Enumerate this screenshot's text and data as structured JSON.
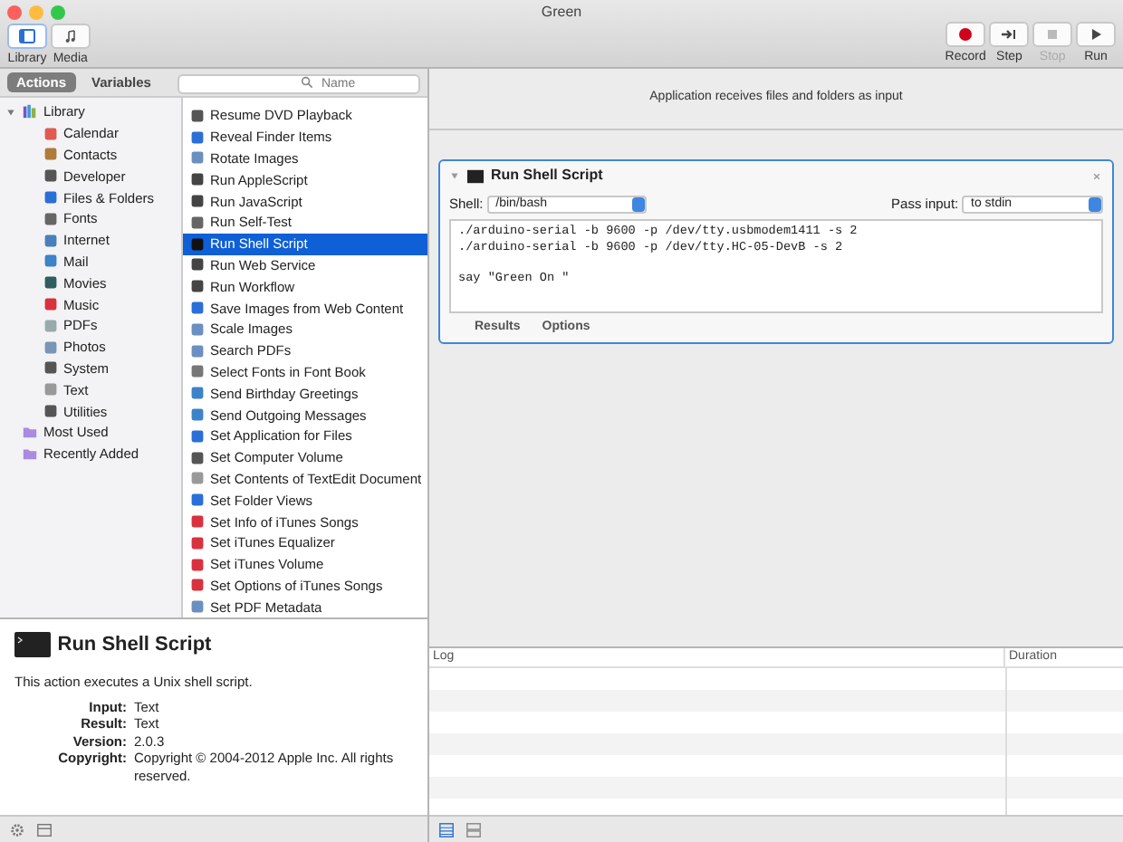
{
  "window": {
    "title": "Green"
  },
  "toolbar_left": [
    {
      "label": "Library",
      "kind": "library",
      "selected": true
    },
    {
      "label": "Media",
      "kind": "media",
      "selected": false
    }
  ],
  "toolbar_right": [
    {
      "label": "Record",
      "kind": "record",
      "disabled": false
    },
    {
      "label": "Step",
      "kind": "step",
      "disabled": false
    },
    {
      "label": "Stop",
      "kind": "stop",
      "disabled": true
    },
    {
      "label": "Run",
      "kind": "run",
      "disabled": false
    }
  ],
  "library_tabs": [
    {
      "label": "Actions",
      "selected": true
    },
    {
      "label": "Variables",
      "selected": false
    }
  ],
  "search": {
    "placeholder": "Name"
  },
  "categories": [
    {
      "label": "Library",
      "kind": "library",
      "expanded": true,
      "children": [
        {
          "label": "Calendar"
        },
        {
          "label": "Contacts"
        },
        {
          "label": "Developer"
        },
        {
          "label": "Files & Folders"
        },
        {
          "label": "Fonts"
        },
        {
          "label": "Internet"
        },
        {
          "label": "Mail"
        },
        {
          "label": "Movies"
        },
        {
          "label": "Music"
        },
        {
          "label": "PDFs"
        },
        {
          "label": "Photos"
        },
        {
          "label": "System"
        },
        {
          "label": "Text"
        },
        {
          "label": "Utilities"
        }
      ]
    },
    {
      "label": "Most Used",
      "kind": "folder"
    },
    {
      "label": "Recently Added",
      "kind": "folder"
    }
  ],
  "actions": [
    {
      "label": "Resume DVD Playback",
      "selected": false
    },
    {
      "label": "Reveal Finder Items",
      "selected": false
    },
    {
      "label": "Rotate Images",
      "selected": false
    },
    {
      "label": "Run AppleScript",
      "selected": false
    },
    {
      "label": "Run JavaScript",
      "selected": false
    },
    {
      "label": "Run Self-Test",
      "selected": false
    },
    {
      "label": "Run Shell Script",
      "selected": true
    },
    {
      "label": "Run Web Service",
      "selected": false
    },
    {
      "label": "Run Workflow",
      "selected": false
    },
    {
      "label": "Save Images from Web Content",
      "selected": false
    },
    {
      "label": "Scale Images",
      "selected": false
    },
    {
      "label": "Search PDFs",
      "selected": false
    },
    {
      "label": "Select Fonts in Font Book",
      "selected": false
    },
    {
      "label": "Send Birthday Greetings",
      "selected": false
    },
    {
      "label": "Send Outgoing Messages",
      "selected": false
    },
    {
      "label": "Set Application for Files",
      "selected": false
    },
    {
      "label": "Set Computer Volume",
      "selected": false
    },
    {
      "label": "Set Contents of TextEdit Document",
      "selected": false
    },
    {
      "label": "Set Folder Views",
      "selected": false
    },
    {
      "label": "Set Info of iTunes Songs",
      "selected": false
    },
    {
      "label": "Set iTunes Equalizer",
      "selected": false
    },
    {
      "label": "Set iTunes Volume",
      "selected": false
    },
    {
      "label": "Set Options of iTunes Songs",
      "selected": false
    },
    {
      "label": "Set PDF Metadata",
      "selected": false
    }
  ],
  "description": {
    "title": "Run Shell Script",
    "summary": "This action executes a Unix shell script.",
    "fields": [
      {
        "label": "Input:",
        "value": "Text"
      },
      {
        "label": "Result:",
        "value": "Text"
      },
      {
        "label": "Version:",
        "value": "2.0.3"
      },
      {
        "label": "Copyright:",
        "value": "Copyright © 2004-2012 Apple Inc.  All rights reserved."
      }
    ]
  },
  "workflow": {
    "input_note": "Application receives files and folders as input",
    "action": {
      "title": "Run Shell Script",
      "expanded": true,
      "shell_label": "Shell:",
      "shell": "/bin/bash",
      "pass_label": "Pass input:",
      "pass": "to stdin",
      "script": "./arduino-serial -b 9600 -p /dev/tty.usbmodem1411 -s 2\n./arduino-serial -b 9600 -p /dev/tty.HC-05-DevB -s 2\n\nsay \"Green On \"",
      "tabs": [
        "Results",
        "Options"
      ]
    }
  },
  "log": {
    "columns": [
      "Log",
      "Duration"
    ]
  }
}
